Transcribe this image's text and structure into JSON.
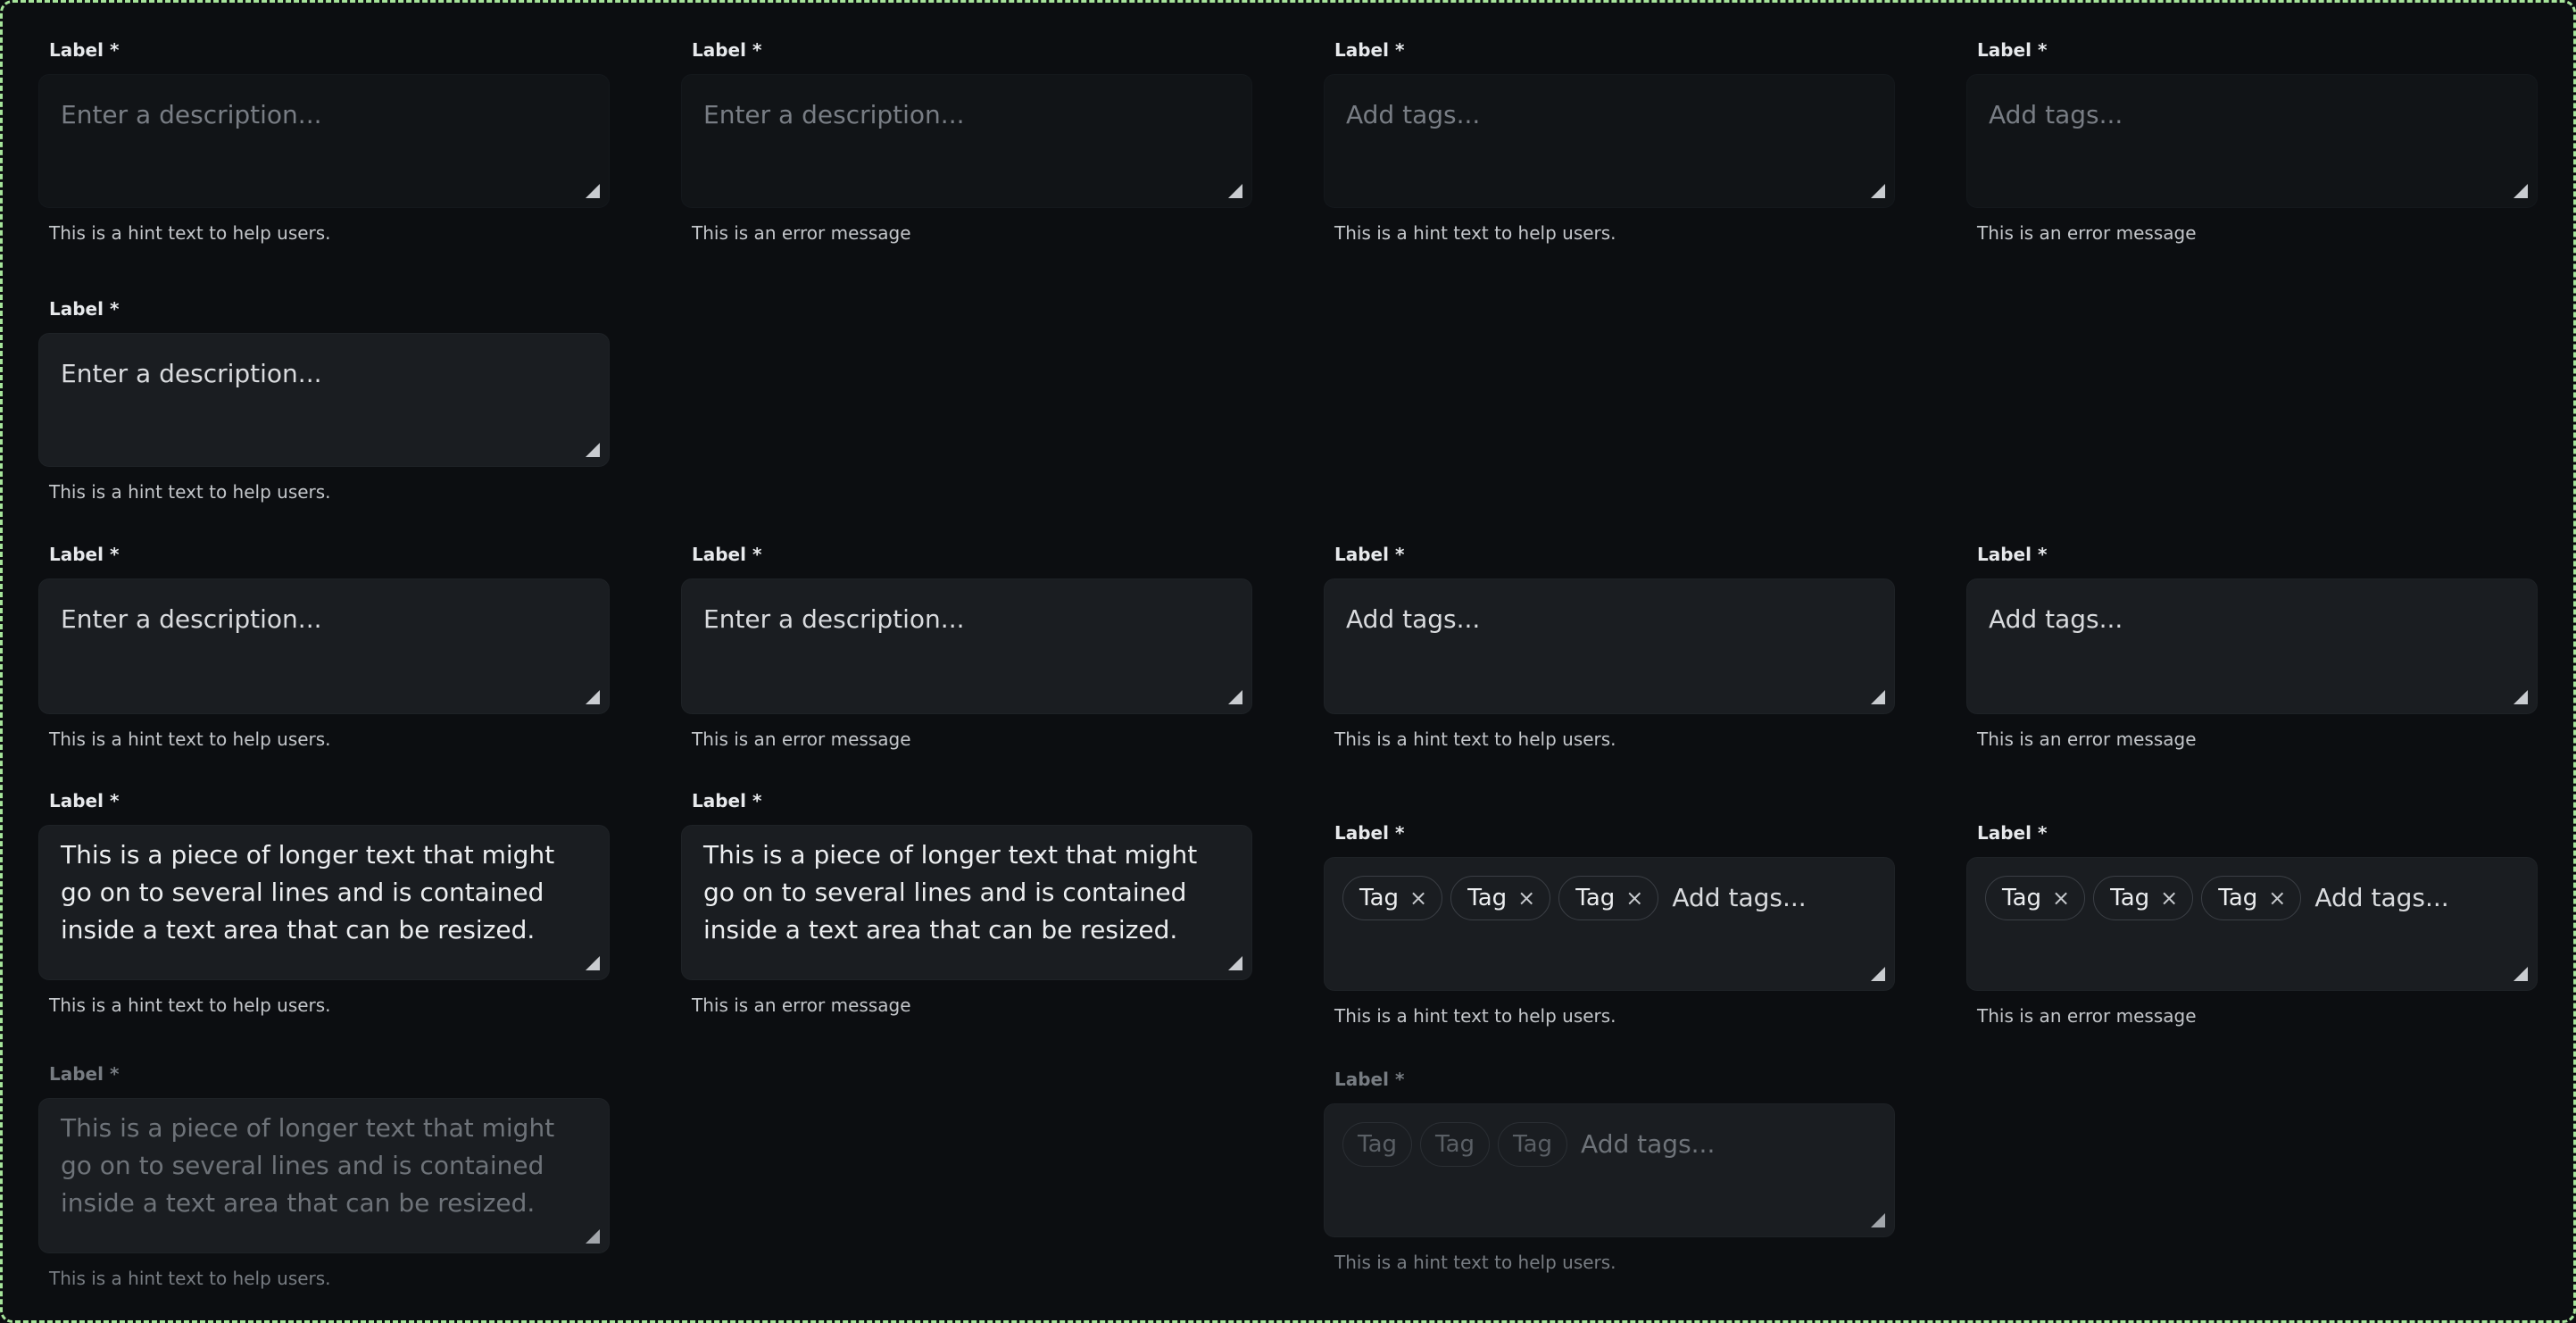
{
  "common": {
    "label": "Label *",
    "hint": "This is a hint text to help users.",
    "error": "This is an error message",
    "description_placeholder": "Enter a description...",
    "tags_placeholder": "Add tags...",
    "tag": "Tag",
    "tag_remove": "×",
    "long_text": "This is a piece of longer text that might go on to several lines and is contained inside a text area that can be resized."
  },
  "colors": {
    "frame_border": "#a6e49a",
    "background": "#0c0e11"
  }
}
